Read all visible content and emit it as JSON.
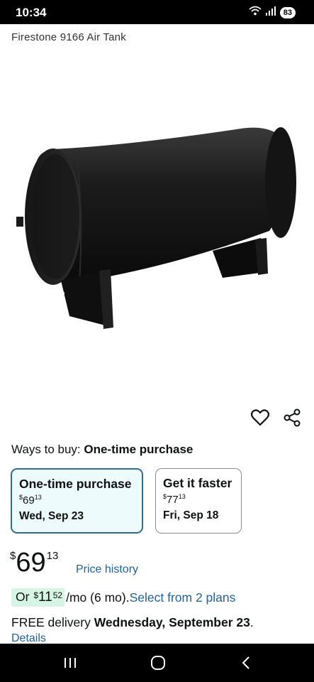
{
  "status_bar": {
    "time": "10:34",
    "wifi_icon": "wifi-icon",
    "signal_icon": "signal-icon",
    "battery_level": "83"
  },
  "product": {
    "title": "Firestone 9166 Air Tank",
    "image_icon": "air-tank-image"
  },
  "actions": {
    "wishlist_icon": "heart-icon",
    "share_icon": "share-icon"
  },
  "ways_to_buy": {
    "label": "Ways to buy:",
    "selected": "One-time purchase"
  },
  "options": [
    {
      "name": "One-time purchase",
      "price_symbol": "$",
      "price_whole": "69",
      "price_fraction": "13",
      "date": "Wed, Sep 23"
    },
    {
      "name": "Get it faster",
      "price_symbol": "$",
      "price_whole": "77",
      "price_fraction": "13",
      "date": "Fri, Sep 18"
    }
  ],
  "price": {
    "symbol": "$",
    "whole": "69",
    "fraction": "13",
    "history_link": "Price history"
  },
  "monthly": {
    "prefix": "Or",
    "symbol": "$",
    "whole": "11",
    "fraction": "52",
    "suffix": "/mo (6 mo).",
    "plans_link": "Select from 2 plans"
  },
  "delivery": {
    "prefix": "FREE delivery",
    "date": "Wednesday, September 23",
    "period": ".",
    "details_link": "Details"
  },
  "nav_bar": {
    "recents_icon": "recents-icon",
    "home_icon": "home-icon",
    "back_icon": "back-icon"
  },
  "colors": {
    "link": "#2162a1",
    "selected_border": "#2d6e8e",
    "selected_bg": "#eefbfd",
    "monthly_highlight": "#d7f5e3"
  }
}
